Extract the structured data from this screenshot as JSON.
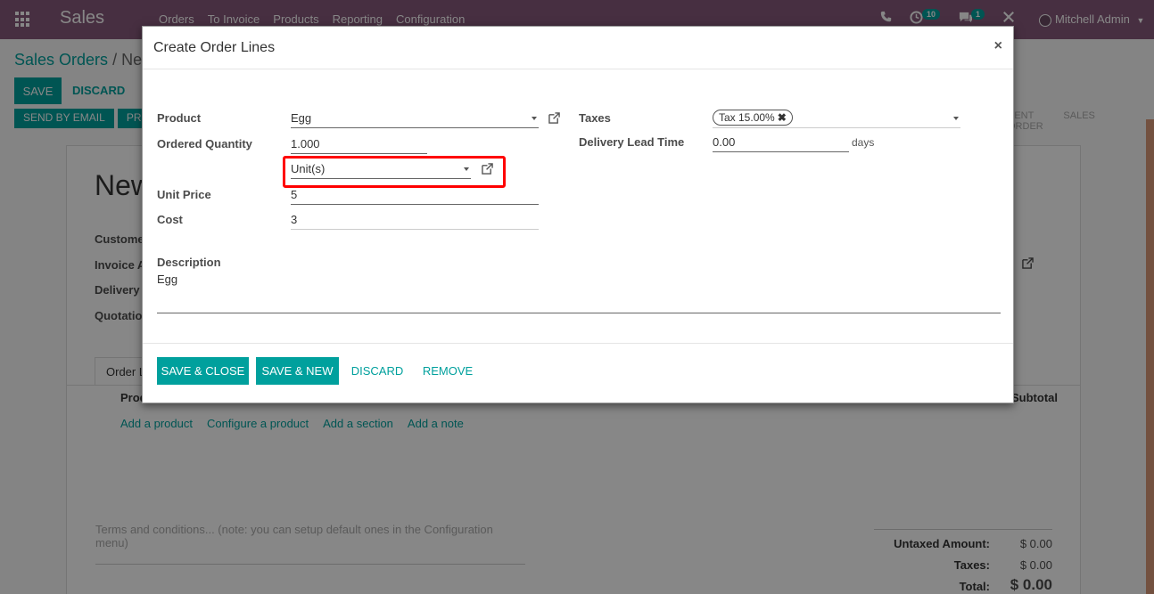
{
  "navbar": {
    "brand": "Sales",
    "menu": [
      "Orders",
      "To Invoice",
      "Products",
      "Reporting",
      "Configuration"
    ],
    "activity_count": "10",
    "messages_count": "1",
    "user_name": "Mitchell Admin"
  },
  "background": {
    "breadcrumb_parent": "Sales Orders",
    "breadcrumb_separator": "/",
    "breadcrumb_current": "Ne",
    "save_label": "SAVE",
    "discard_label": "DISCARD",
    "send_email_label": "SEND BY EMAIL",
    "pr_label": "PR",
    "stage_sent": "SENT",
    "stage_sales_order": "SALES ORDER",
    "title": "New",
    "side_labels": [
      "Custome",
      "Invoice A",
      "Delivery A",
      "Quotation"
    ],
    "tab_order_lines": "Order L",
    "col_product": "Prod",
    "col_subtotal": "Subtotal",
    "add_links": [
      "Add a product",
      "Configure a product",
      "Add a section",
      "Add a note"
    ],
    "terms_placeholder": "Terms and conditions... (note: you can setup default ones in the Configuration menu)",
    "totals": [
      {
        "label": "Untaxed Amount:",
        "value": "$ 0.00"
      },
      {
        "label": "Taxes:",
        "value": "$ 0.00"
      },
      {
        "label": "Total:",
        "value": "$ 0.00"
      }
    ]
  },
  "modal": {
    "title": "Create Order Lines",
    "close": "×",
    "labels": {
      "product": "Product",
      "ordered_quantity": "Ordered Quantity",
      "unit_price": "Unit Price",
      "cost": "Cost",
      "description": "Description",
      "taxes": "Taxes",
      "delivery_lead_time": "Delivery Lead Time"
    },
    "values": {
      "product": "Egg",
      "ordered_quantity": "1.000",
      "uom": "Unit(s)",
      "unit_price": "5",
      "cost": "3",
      "description": "Egg",
      "tax_tag": "Tax 15.00%",
      "tax_tag_remove": "✖",
      "delivery_lead_time": "0.00",
      "delivery_unit": "days"
    },
    "buttons": {
      "save_close": "SAVE & CLOSE",
      "save_new": "SAVE & NEW",
      "discard": "DISCARD",
      "remove": "REMOVE"
    }
  },
  "colors": {
    "brand": "#875a7b",
    "accent": "#00a09d",
    "highlight": "#ff0000"
  }
}
